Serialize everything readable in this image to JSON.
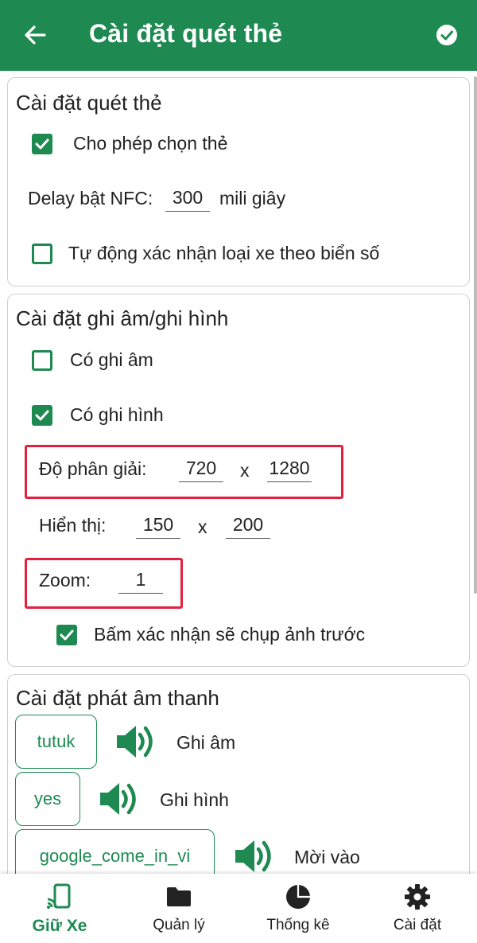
{
  "appbar": {
    "title": "Cài đặt quét thẻ"
  },
  "card_scan": {
    "title": "Cài đặt quét thẻ",
    "allow_choose_card": {
      "label": "Cho phép chọn thẻ",
      "checked": true
    },
    "nfc_delay": {
      "label": "Delay bật NFC:",
      "value": "300",
      "unit": "mili giây"
    },
    "auto_confirm": {
      "label": "Tự động xác nhận loại xe theo biển số",
      "checked": false
    }
  },
  "card_record": {
    "title": "Cài đặt ghi âm/ghi hình",
    "audio": {
      "label": "Có ghi âm",
      "checked": false
    },
    "video": {
      "label": "Có ghi hình",
      "checked": true
    },
    "resolution": {
      "label": "Độ phân giải:",
      "width": "720",
      "sep": "x",
      "height": "1280"
    },
    "display": {
      "label": "Hiển thị:",
      "width": "150",
      "sep": "x",
      "height": "200"
    },
    "zoom": {
      "label": "Zoom:",
      "value": "1"
    },
    "capture_before": {
      "label": "Bấm xác nhận sẽ chụp ảnh trước",
      "checked": true
    }
  },
  "card_sound": {
    "title": "Cài đặt phát âm thanh",
    "items": [
      {
        "sound": "tutuk",
        "label": "Ghi âm"
      },
      {
        "sound": "yes",
        "label": "Ghi hình"
      },
      {
        "sound": "google_come_in_vi",
        "label": "Mời vào"
      }
    ]
  },
  "bottom_nav": {
    "items": [
      {
        "label": "Giữ Xe",
        "icon": "cast-phone-icon",
        "active": true
      },
      {
        "label": "Quản lý",
        "icon": "folder-icon",
        "active": false
      },
      {
        "label": "Thống kê",
        "icon": "pie-chart-icon",
        "active": false
      },
      {
        "label": "Cài đặt",
        "icon": "gear-icon",
        "active": false
      }
    ]
  },
  "colors": {
    "primary": "#1e8a52",
    "highlight": "#e3213f"
  }
}
